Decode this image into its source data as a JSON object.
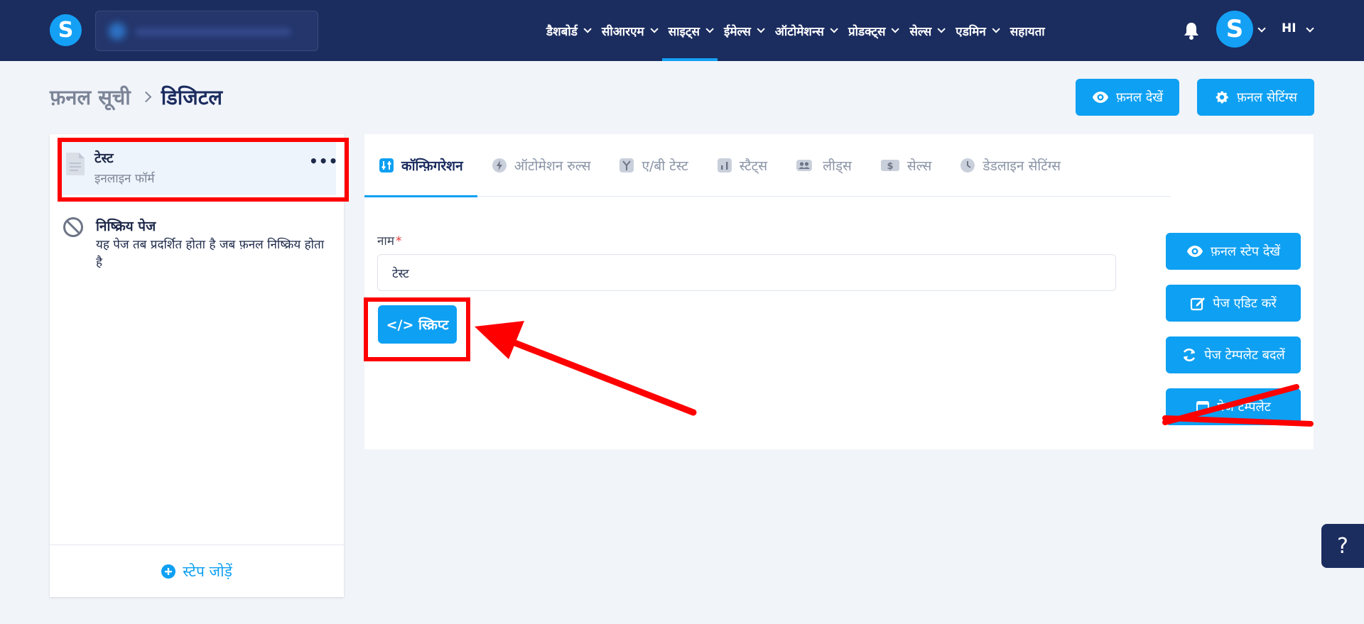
{
  "header": {
    "logo_letter": "S",
    "nav": [
      {
        "label": "डैशबोर्ड",
        "chevron": true
      },
      {
        "label": "सीआरएम",
        "chevron": true
      },
      {
        "label": "साइट्स",
        "chevron": true,
        "active": true
      },
      {
        "label": "ईमेल्स",
        "chevron": true
      },
      {
        "label": "ऑटोमेशन्स",
        "chevron": true
      },
      {
        "label": "प्रोडक्ट्स",
        "chevron": true
      },
      {
        "label": "सेल्स",
        "chevron": true
      },
      {
        "label": "एडमिन",
        "chevron": true
      },
      {
        "label": "सहायता",
        "chevron": false
      }
    ],
    "avatar_letter": "S",
    "language": "HI"
  },
  "breadcrumb": {
    "parent": "फ़नल सूची",
    "current": "डिजिटल"
  },
  "top_actions": {
    "view_funnel": "फ़नल देखें",
    "funnel_settings": "फ़नल सेटिंग्स"
  },
  "steps_panel": {
    "step": {
      "title": "टेस्ट",
      "subtitle": "इनलाइन फॉर्म",
      "more": "•••"
    },
    "inactive_page": {
      "title": "निष्क्रिय पेज",
      "description": "यह पेज तब प्रदर्शित होता है जब फ़नल निष्क्रिय होता है"
    },
    "add_step": "स्टेप जोड़ें"
  },
  "tabs": [
    {
      "label": "कॉन्फ़िगरेशन",
      "icon": "sliders-icon",
      "active": true
    },
    {
      "label": "ऑटोमेशन रुल्स",
      "icon": "bolt-icon"
    },
    {
      "label": "ए/बी टेस्ट",
      "icon": "split-icon"
    },
    {
      "label": "स्टैट्स",
      "icon": "bar-chart-icon"
    },
    {
      "label": "लीड्स",
      "icon": "users-icon"
    },
    {
      "label": "सेल्स",
      "icon": "dollar-icon"
    },
    {
      "label": "डेडलाइन सेटिंग्स",
      "icon": "clock-icon"
    }
  ],
  "form": {
    "name_label": "नाम",
    "required_mark": "*",
    "name_value": "टेस्ट",
    "script_button": "</> स्क्रिप्ट"
  },
  "side_actions": {
    "view_step": "फ़नल स्टेप देखें",
    "edit_page": "पेज एडिट करें",
    "change_template": "पेज टेम्पलेट बदलें",
    "hidden_action": "पेज टेम्पलेट"
  },
  "help": "?",
  "colors": {
    "header_bg": "#1b2c5f",
    "accent": "#0ea0f2",
    "annotation": "#ff0000",
    "page_bg": "#f1f4f9"
  }
}
